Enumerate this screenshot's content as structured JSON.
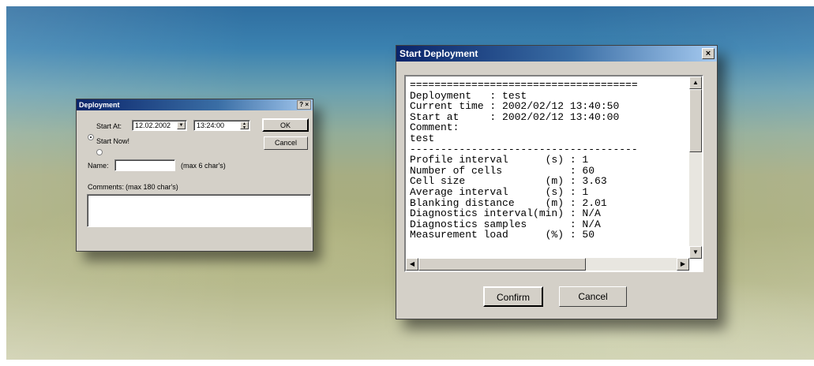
{
  "deployment_dialog": {
    "title": "Deployment",
    "title_buttons": "? ×",
    "start_at_label": "Start At:",
    "date_value": "12.02.2002",
    "time_value": "13:24:00",
    "start_now_label": "Start Now!",
    "ok_label": "OK",
    "cancel_label": "Cancel",
    "name_label": "Name:",
    "name_value": "",
    "name_hint": "(max 6 char's)",
    "comments_label": "Comments:",
    "comments_hint": "(max 180 char's)",
    "comments_value": ""
  },
  "start_dialog": {
    "title": "Start Deployment",
    "close_glyph": "×",
    "lines": [
      "=====================================",
      "Deployment   : test",
      "Current time : 2002/02/12 13:40:50",
      "Start at     : 2002/02/12 13:40:00",
      "Comment:",
      "test",
      "-------------------------------------",
      "Profile interval      (s) : 1",
      "Number of cells           : 60",
      "Cell size             (m) : 3.63",
      "Average interval      (s) : 1",
      "Blanking distance     (m) : 2.01",
      "Diagnostics interval(min) : N/A",
      "Diagnostics samples       : N/A",
      "Measurement load      (%) : 50"
    ],
    "confirm_label": "Confirm",
    "cancel_label": "Cancel"
  }
}
